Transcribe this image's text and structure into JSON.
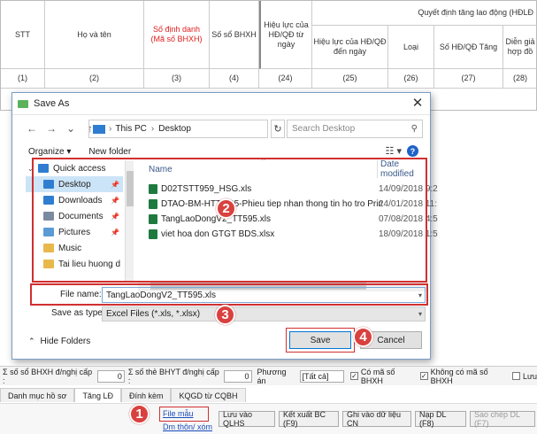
{
  "grid": {
    "headers": {
      "stt": "STT",
      "ho_va_ten": "Họ và tên",
      "so_dinh_danh": "Số định danh (Mã số BHXH)",
      "so_so_bhxh": "Số sổ BHXH",
      "group": "Quyết định tăng lao động (HĐLĐ",
      "hieu_luc_tu": "Hiệu lực của HĐ/QĐ từ ngày",
      "hieu_luc_den": "Hiệu lực của HĐ/QĐ đến ngày",
      "loai": "Loại",
      "so_hd": "Số HĐ/QĐ Tăng",
      "dien_giai": "Diễn giả hợp đồ"
    },
    "col_numbers": [
      "(1)",
      "(2)",
      "(3)",
      "(4)",
      "(24)",
      "(25)",
      "(26)",
      "(27)",
      "(28)"
    ]
  },
  "dialog": {
    "title": "Save As",
    "close": "✕",
    "nav": {
      "back": "←",
      "forward": "→",
      "down": "⌄",
      "up": "↑"
    },
    "address": {
      "part1": "This PC",
      "sep": "›",
      "part2": "Desktop",
      "arrow": "›"
    },
    "refresh": "↻",
    "search_placeholder": "Search Desktop",
    "organize": "Organize ▾",
    "new_folder": "New folder",
    "view_icons": "☷ ▾",
    "help": "?",
    "nav_items": [
      {
        "label": "Quick access",
        "color": "#2e7dd1"
      },
      {
        "label": "Desktop",
        "color": "#2e7dd1"
      },
      {
        "label": "Downloads",
        "color": "#2e7dd1"
      },
      {
        "label": "Documents",
        "color": "#7a8aa0"
      },
      {
        "label": "Pictures",
        "color": "#5b9bd5"
      },
      {
        "label": "Music",
        "color": "#e8b84a"
      },
      {
        "label": "Tai lieu huong d",
        "color": "#e8b84a"
      }
    ],
    "file_header": {
      "name": "Name",
      "date": "Date modified"
    },
    "files": [
      {
        "name": "D02TSTT959_HSG.xls",
        "date": "14/09/2018 9:2"
      },
      {
        "name": "DTAO-BM-HTTT-05-Phieu tiep nhan thong tin ho tro Prin...",
        "date": "24/01/2018 11:"
      },
      {
        "name": "TangLaoDongV2_TT595.xls",
        "date": "07/08/2018 4:5"
      },
      {
        "name": "viet hoa don GTGT BDS.xlsx",
        "date": "18/09/2018 1:5"
      }
    ],
    "file_name_label": "File name:",
    "file_name_value": "TangLaoDongV2_TT595.xls",
    "save_as_type_label": "Save as type:",
    "save_as_type_value": "Excel Files (*.xls, *.xlsx)",
    "hide_folders": "Hide Folders",
    "save_button": "Save",
    "cancel_button": "Cancel"
  },
  "callouts": [
    "1",
    "2",
    "3",
    "4"
  ],
  "summary_row": {
    "sum_bhxh_label": "Σ số sổ BHXH đ/nghị cấp :",
    "sum_bhxh_value": "0",
    "sum_bhyt_label": "Σ số thẻ BHYT đ/nghị cấp :",
    "sum_bhyt_value": "0",
    "phuong_an": "Phương án",
    "phuong_an_value": "[Tất cả]",
    "co_ma_so": "Có mã số BHXH",
    "khong_co_ma_so": "Không có mã số BHXH",
    "luu": "Lưu"
  },
  "tabs": [
    "Danh mục hồ sơ",
    "Tăng LĐ",
    "Đính kèm",
    "KQGD từ CQBH"
  ],
  "actions": {
    "file_mau": "File mẫu",
    "dm_thon_xom": "Dm thôn/ xóm",
    "luu_qlhs": "Lưu vào QLHS",
    "ket_xuat": "Kết xuất BC (F9)",
    "ghi_du_lieu": "Ghi vào dữ liệu CN",
    "nap_dl": "Nạp DL (F8)",
    "sao_chep": "Sao chép DL (F7)"
  }
}
